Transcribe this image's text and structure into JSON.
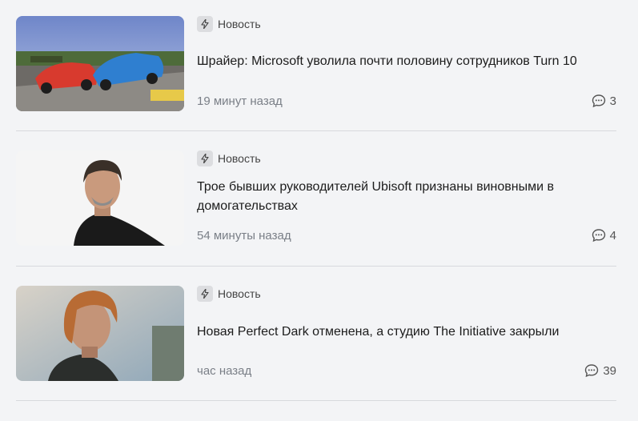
{
  "articles": [
    {
      "category": "Новость",
      "title": "Шрайер: Microsoft уволила почти половину сотрудников Turn 10",
      "time": "19 минут назад",
      "comments": "3",
      "image": "racing-cars-photo"
    },
    {
      "category": "Новость",
      "title": "Трое бывших руководителей Ubisoft признаны виновными в домогательствах",
      "time": "54 минуты назад",
      "comments": "4",
      "image": "executive-portrait-photo"
    },
    {
      "category": "Новость",
      "title": "Новая Perfect Dark отменена, а студию The Initiative закрыли",
      "time": "час назад",
      "comments": "39",
      "image": "game-character-photo"
    }
  ],
  "icons": {
    "category": "lightning-icon",
    "comments": "comment-icon"
  },
  "colors": {
    "background": "#f3f4f6",
    "badge": "#dcdde0",
    "muted_text": "#7a7f87"
  }
}
